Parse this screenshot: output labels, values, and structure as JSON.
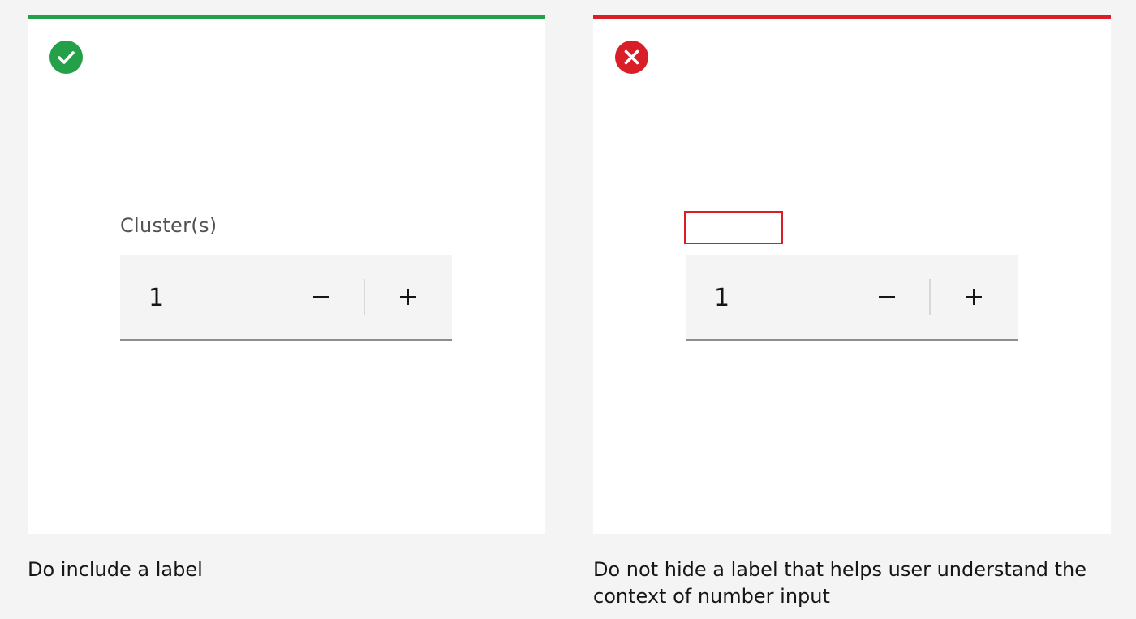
{
  "do_card": {
    "status_icon": "checkmark-circle-icon",
    "status_color": "#24a148",
    "field_label": "Cluster(s)",
    "input_value": "1",
    "decrement_icon": "minus-icon",
    "increment_icon": "plus-icon",
    "caption": "Do include a label"
  },
  "dont_card": {
    "status_icon": "close-circle-icon",
    "status_color": "#da1e28",
    "field_label": "",
    "input_value": "1",
    "decrement_icon": "minus-icon",
    "increment_icon": "plus-icon",
    "caption": "Do not hide a label that helps user understand the context of number input"
  }
}
